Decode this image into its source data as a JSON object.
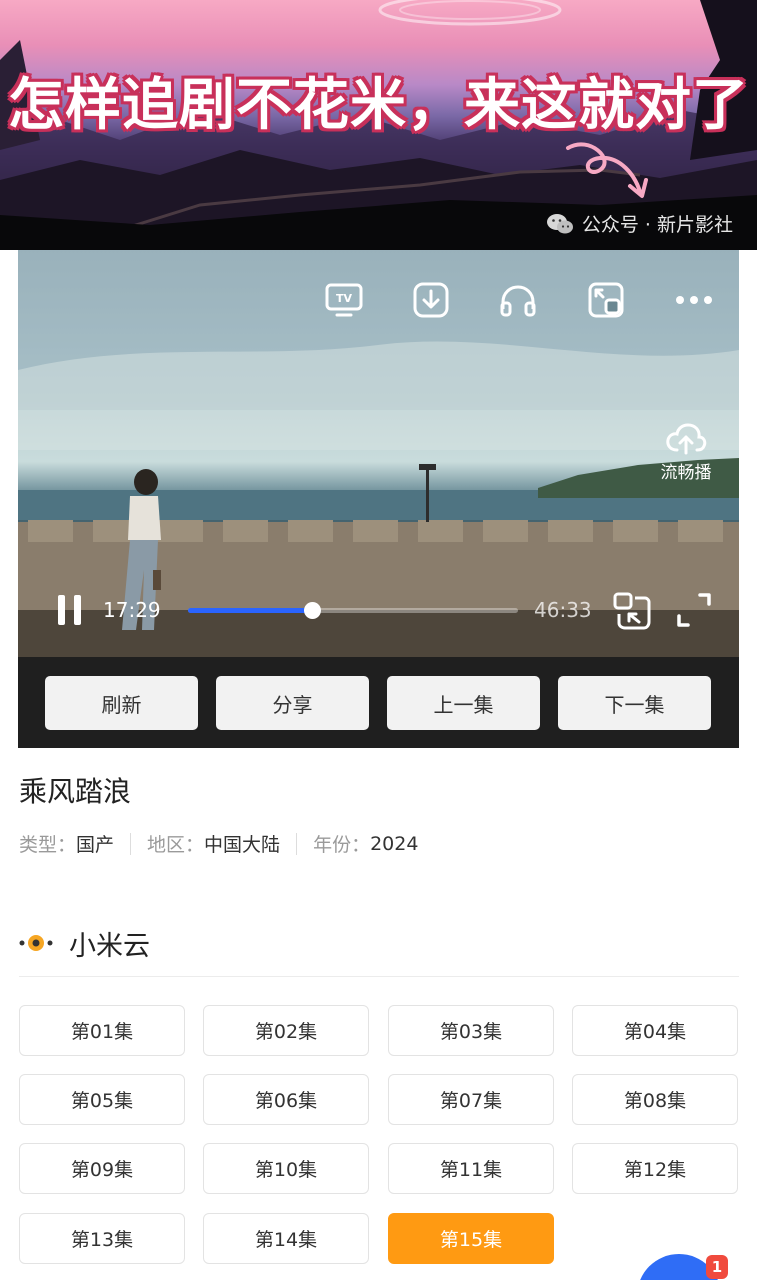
{
  "banner": {
    "title": "怎样追剧不花米，来这就对了",
    "watermark": "公众号 · 新片影社",
    "watermark_icon": "wechat-icon"
  },
  "player": {
    "top_icons": [
      "tv-cast-icon",
      "download-icon",
      "headphones-icon",
      "pip-icon",
      "more-icon"
    ],
    "smooth_label": "流畅播",
    "current_time": "17:29",
    "total_time": "46:33",
    "progress_fraction": 0.3756,
    "accent": "#2a64ff"
  },
  "actions": [
    "刷新",
    "分享",
    "上一集",
    "下一集"
  ],
  "show": {
    "title": "乘风踏浪",
    "type_label": "类型：",
    "type_value": "国产",
    "region_label": "地区：",
    "region_value": "中国大陆",
    "year_label": "年份：",
    "year_value": "2024"
  },
  "source": {
    "name": "小米云",
    "icon": "source-eye-icon"
  },
  "episodes": {
    "items": [
      "第01集",
      "第02集",
      "第03集",
      "第04集",
      "第05集",
      "第06集",
      "第07集",
      "第08集",
      "第09集",
      "第10集",
      "第11集",
      "第12集",
      "第13集",
      "第14集",
      "第15集"
    ],
    "active_index": 14,
    "active_color": "#ff9a12"
  },
  "fab": {
    "badge": "1",
    "color": "#2f6df6"
  }
}
